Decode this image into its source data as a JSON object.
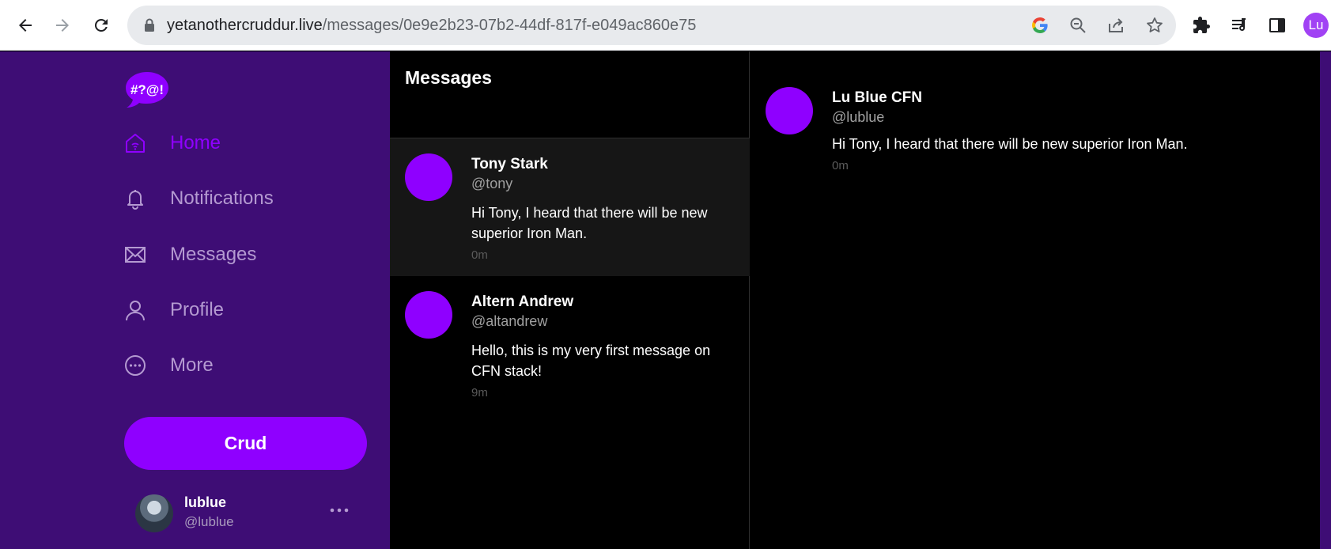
{
  "browser": {
    "url_host": "yetanothercruddur.live",
    "url_path": "/messages/0e9e2b23-07b2-44df-817f-e049ac860e75",
    "profile_initials": "Lu"
  },
  "sidebar": {
    "logo_text": "#?@!",
    "items": [
      {
        "label": "Home",
        "icon": "home-icon",
        "active": true
      },
      {
        "label": "Notifications",
        "icon": "bell-icon",
        "active": false
      },
      {
        "label": "Messages",
        "icon": "mail-icon",
        "active": false
      },
      {
        "label": "Profile",
        "icon": "person-icon",
        "active": false
      },
      {
        "label": "More",
        "icon": "more-circle-icon",
        "active": false
      }
    ],
    "crud_label": "Crud",
    "user": {
      "name": "lublue",
      "handle": "@lublue"
    }
  },
  "messages": {
    "title": "Messages",
    "conversations": [
      {
        "name": "Tony Stark",
        "handle": "@tony",
        "text": "Hi Tony, I heard that there will be new superior Iron Man.",
        "time": "0m",
        "selected": true
      },
      {
        "name": "Altern Andrew",
        "handle": "@altandrew",
        "text": "Hello, this is my very first message on CFN stack!",
        "time": "9m",
        "selected": false
      }
    ]
  },
  "thread": {
    "messages": [
      {
        "name": "Lu Blue CFN",
        "handle": "@lublue",
        "text": "Hi Tony, I heard that there will be new superior Iron Man.",
        "time": "0m"
      }
    ]
  },
  "colors": {
    "accent": "#8f00ff",
    "sidebar_bg": "#3e0d75"
  }
}
